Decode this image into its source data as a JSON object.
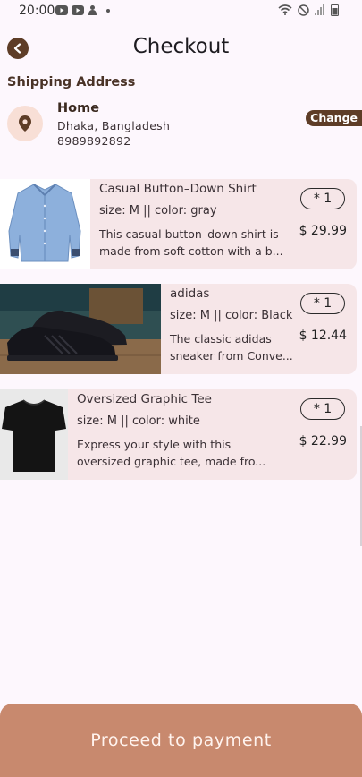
{
  "status_bar": {
    "time": "20:00",
    "left_icons": [
      "youtube-icon",
      "youtube-icon",
      "notification-icon",
      "dot-icon"
    ],
    "right_icons": [
      "wifi-icon",
      "do-not-disturb-icon",
      "signal-icon",
      "battery-icon"
    ]
  },
  "app_bar": {
    "title": "Checkout",
    "back_icon": "back-arrow-icon"
  },
  "shipping": {
    "section_title": "Shipping Address",
    "name": "Home",
    "address_line1": "Dhaka, Bangladesh",
    "address_line2": "8989892892",
    "change_label": "Change",
    "pin_icon": "location-pin-icon"
  },
  "products": [
    {
      "name": "Casual Button–Down Shirt",
      "size_color": "size: M || color: gray",
      "description_line1": "This casual button–down shirt is",
      "description_line2": "made from soft cotton with a b...",
      "quantity": "* 1",
      "price": "$ 29.99",
      "image": "blue-shirt-image"
    },
    {
      "name": "adidas",
      "size_color": "size: M || color: Black",
      "description_line1": "The classic adidas",
      "description_line2": "sneaker from Conve...",
      "quantity": "* 1",
      "price": "$ 12.44",
      "image": "black-sneaker-image"
    },
    {
      "name": "Oversized Graphic Tee",
      "size_color": "size: M || color: white",
      "description_line1": "Express your style with this",
      "description_line2": "oversized graphic tee, made fro...",
      "quantity": "* 1",
      "price": "$ 22.99",
      "image": "black-tshirt-image"
    }
  ],
  "footer": {
    "proceed_label": "Proceed to payment"
  },
  "colors": {
    "background": "#fdf7fd",
    "accent_brown": "#5e3d27",
    "card_background": "#f6e6e8",
    "button_background": "#c8896e",
    "pin_circle": "#f8dfd6"
  }
}
